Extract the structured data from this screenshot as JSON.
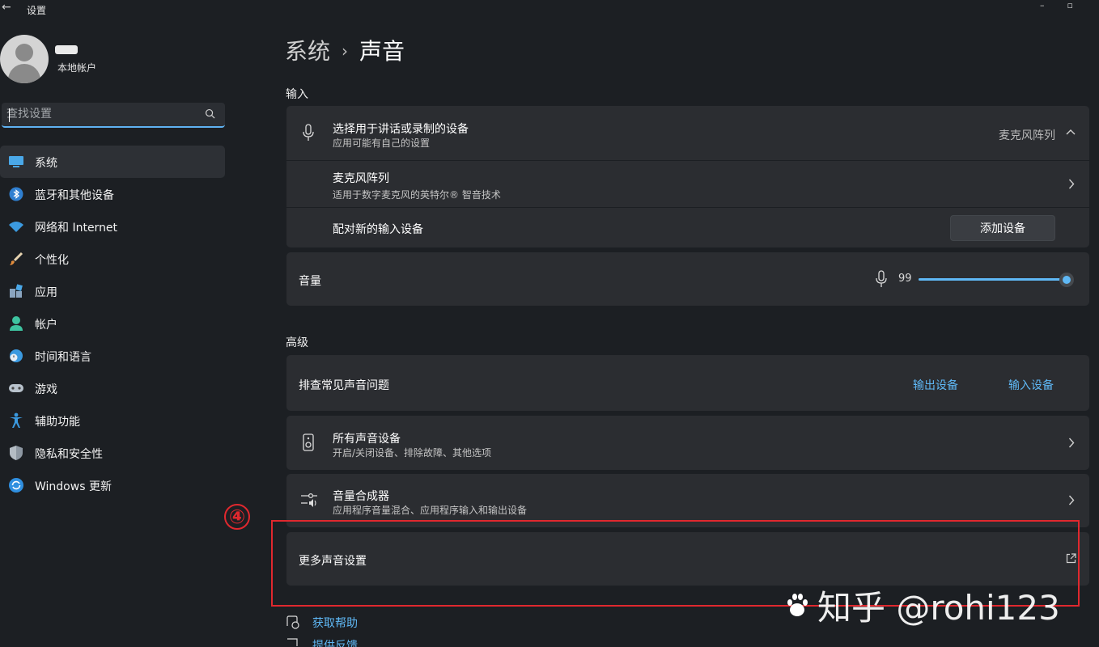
{
  "app": {
    "title": "设置"
  },
  "user": {
    "account_type": "本地帐户"
  },
  "search": {
    "placeholder": "查找设置"
  },
  "sidebar": {
    "items": [
      {
        "label": "系统",
        "icon": "monitor-icon",
        "active": true
      },
      {
        "label": "蓝牙和其他设备",
        "icon": "bluetooth-icon"
      },
      {
        "label": "网络和 Internet",
        "icon": "wifi-icon"
      },
      {
        "label": "个性化",
        "icon": "brush-icon"
      },
      {
        "label": "应用",
        "icon": "apps-icon"
      },
      {
        "label": "帐户",
        "icon": "person-icon"
      },
      {
        "label": "时间和语言",
        "icon": "globe-clock-icon"
      },
      {
        "label": "游戏",
        "icon": "gamepad-icon"
      },
      {
        "label": "辅助功能",
        "icon": "accessibility-icon"
      },
      {
        "label": "隐私和安全性",
        "icon": "shield-icon"
      },
      {
        "label": "Windows 更新",
        "icon": "update-icon"
      }
    ]
  },
  "breadcrumb": {
    "parent": "系统",
    "separator": "›",
    "current": "声音"
  },
  "input": {
    "section_label": "输入",
    "device_select": {
      "title": "选择用于讲话或录制的设备",
      "subtitle": "应用可能有自己的设置",
      "value": "麦克风阵列"
    },
    "device": {
      "title": "麦克风阵列",
      "subtitle": "适用于数字麦克风的英特尔® 智音技术"
    },
    "pair": {
      "title": "配对新的输入设备",
      "button": "添加设备"
    },
    "volume": {
      "title": "音量",
      "value": "99",
      "level": 0.99
    }
  },
  "advanced": {
    "section_label": "高级",
    "troubleshoot": {
      "title": "排查常见声音问题",
      "link_output": "输出设备",
      "link_input": "输入设备"
    },
    "all_devices": {
      "title": "所有声音设备",
      "subtitle": "开启/关闭设备、排除故障、其他选项"
    },
    "mixer": {
      "title": "音量合成器",
      "subtitle": "应用程序音量混合、应用程序输入和输出设备"
    },
    "more": {
      "title": "更多声音设置"
    }
  },
  "annotation": {
    "step": "④"
  },
  "help": {
    "get_help": "获取帮助",
    "feedback": "提供反馈"
  },
  "watermark": {
    "text": "知乎 @rohi123"
  },
  "colors": {
    "accent": "#5fb8f5",
    "highlight": "#e0282e",
    "background": "#1c1f23",
    "card": "#2b2d31"
  }
}
